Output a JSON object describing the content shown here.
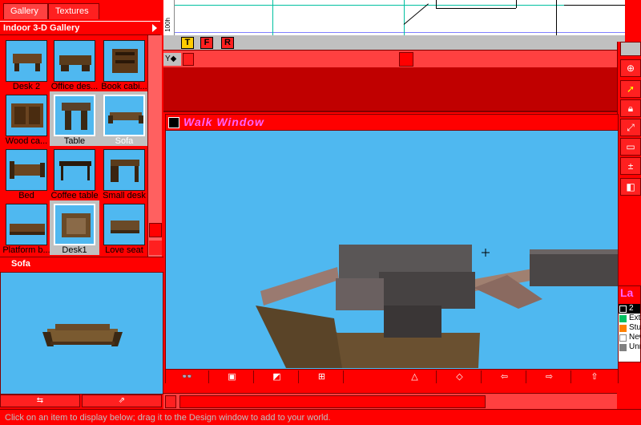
{
  "left_panel": {
    "tabs": [
      {
        "label": "Gallery"
      },
      {
        "label": "Textures"
      }
    ],
    "gallery_title": "Indoor 3-D Gallery",
    "items": [
      {
        "label": "Desk 2"
      },
      {
        "label": "Office des..."
      },
      {
        "label": "Book cabi..."
      },
      {
        "label": "Wood ca..."
      },
      {
        "label": "Table"
      },
      {
        "label": "Sofa"
      },
      {
        "label": "Bed"
      },
      {
        "label": "Coffee table"
      },
      {
        "label": "Small desk"
      },
      {
        "label": "Platform b..."
      },
      {
        "label": "Desk1"
      },
      {
        "label": "Love seat"
      }
    ],
    "selected_item": "Sofa",
    "preview_title": "Sofa"
  },
  "design_window": {
    "tools": [
      "T",
      "F",
      "R"
    ],
    "ruler_label": "100h",
    "y_display": "Y◆"
  },
  "walk_window": {
    "title": "Walk Window",
    "tools": [
      "👓",
      "▣",
      "◩",
      "⊞",
      "△",
      "◇",
      "⇦",
      "⇨",
      "⇧"
    ]
  },
  "right_toolbar": {
    "icons": [
      "zoom-icon",
      "pointer-icon",
      "lock-icon",
      "rotate-icon",
      "rectangle-icon",
      "add-remove-icon",
      "layer-icon"
    ]
  },
  "layers": {
    "title": "La",
    "rows": [
      {
        "label": "2",
        "color": "#000000"
      },
      {
        "label": "Ext",
        "color": "#00c060"
      },
      {
        "label": "Stu",
        "color": "#ff8000"
      },
      {
        "label": "New",
        "color": "#ffffff"
      },
      {
        "label": "Unn",
        "color": "#808080"
      }
    ]
  },
  "status": {
    "text": "Click on an item to display below; drag it to the Design window to add to your world."
  },
  "colors": {
    "panel": "#ff0000",
    "sky": "#4fb8f0",
    "walk_title_text": "#ff60ff"
  }
}
